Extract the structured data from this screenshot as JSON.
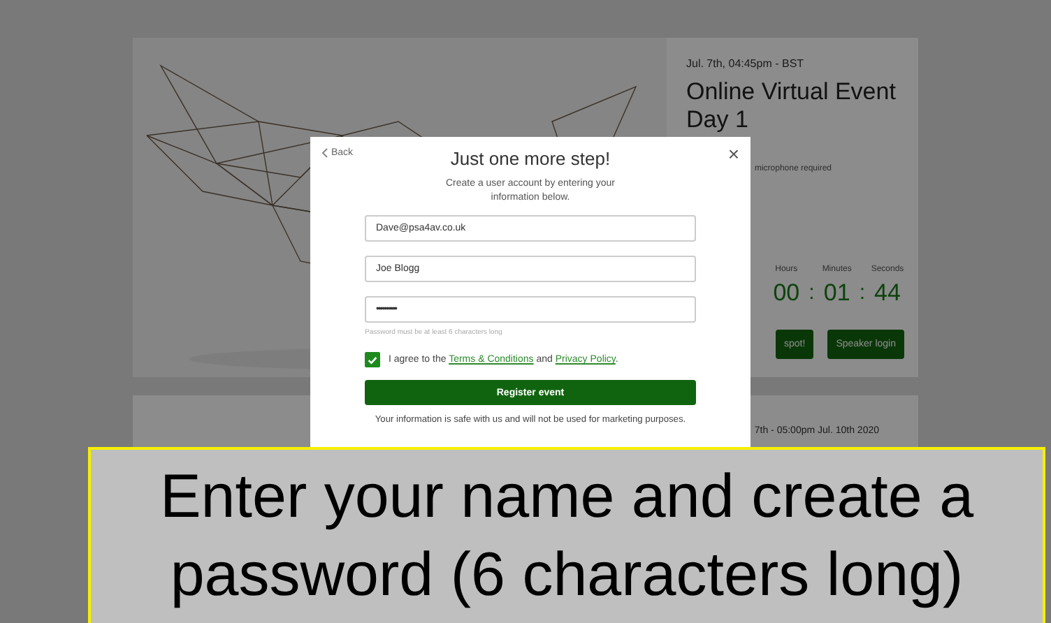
{
  "event_card": {
    "date": "Jul. 7th, 04:45pm - BST",
    "title": "Online Virtual Event Day 1",
    "note": "microphone required",
    "separator": ":",
    "countdown": [
      {
        "unit": "Hours",
        "value": "00"
      },
      {
        "unit": "Minutes",
        "value": "01"
      },
      {
        "unit": "Seconds",
        "value": "44"
      }
    ],
    "buttons": [
      "spot!",
      "Speaker login"
    ]
  },
  "second_card": {
    "date": "7th - 05:00pm Jul. 10th 2020"
  },
  "modal": {
    "back": "Back",
    "close": "×",
    "title": "Just one more step!",
    "subtitle": "Create a user account by entering your information below.",
    "fields": [
      {
        "kind": "text",
        "value": "Dave@psa4av.co.uk"
      },
      {
        "kind": "text",
        "value": "Joe Blogg"
      },
      {
        "kind": "password",
        "value": "••••••••••"
      }
    ],
    "hint": "Password must be at least 6 characters long",
    "consent": {
      "checked": true,
      "text": "I agree to the ",
      "link1": "Terms & Conditions",
      "middle": " and ",
      "link2": "Privacy Policy",
      "end": "."
    },
    "submit": "Register event",
    "footer": "Your information is safe with us and will not be used for marketing purposes."
  },
  "caption": {
    "lines": [
      "Enter your name and create a",
      "password (6 characters long)"
    ]
  }
}
